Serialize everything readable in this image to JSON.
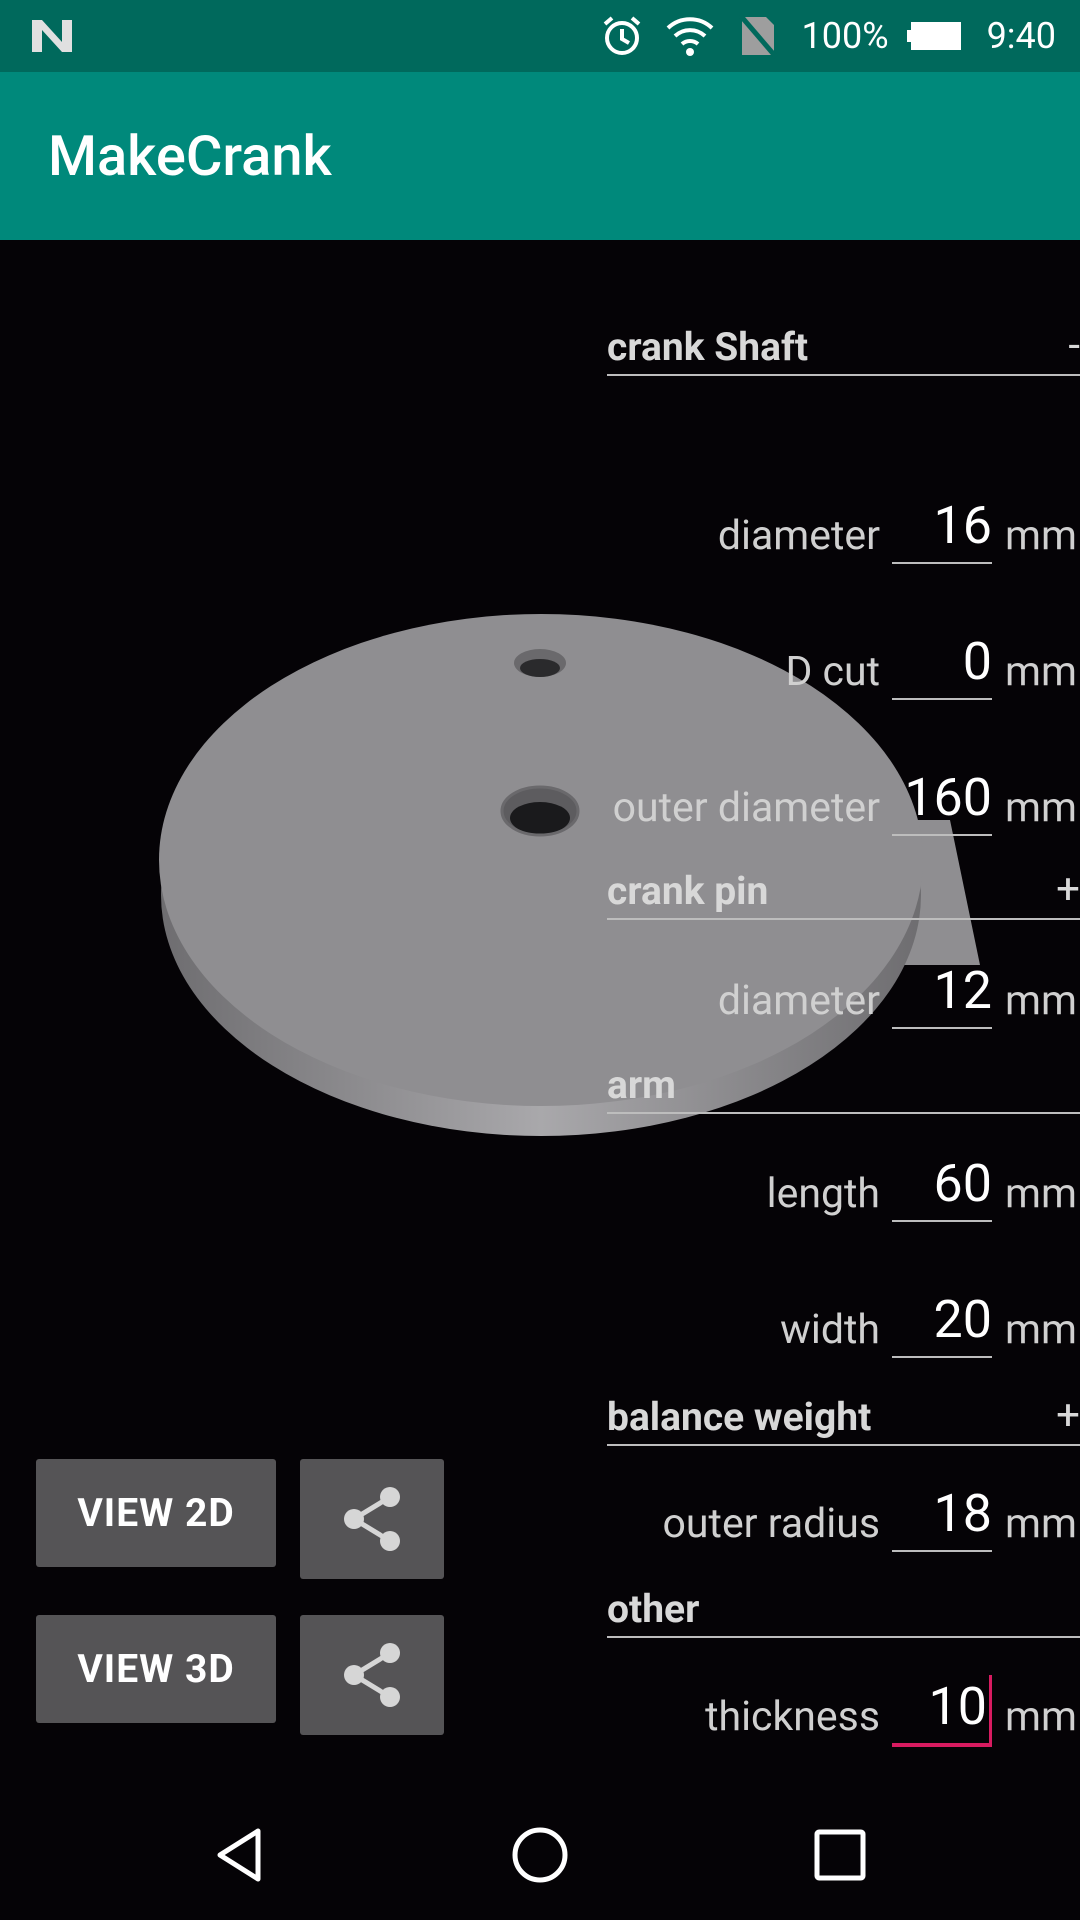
{
  "status_bar": {
    "battery": "100%",
    "time": "9:40",
    "icons": [
      "n-logo-icon",
      "alarm-icon",
      "wifi-icon",
      "no-sim-icon",
      "battery-icon"
    ]
  },
  "app_bar": {
    "title": "MakeCrank"
  },
  "sections": {
    "crank_shaft": {
      "label": "crank Shaft",
      "toggle": "-"
    },
    "crank_pin": {
      "label": "crank pin",
      "toggle": "+"
    },
    "arm": {
      "label": "arm",
      "toggle": ""
    },
    "balance_weight": {
      "label": "balance weight",
      "toggle": "+"
    },
    "other": {
      "label": "other",
      "toggle": ""
    }
  },
  "fields": {
    "shaft_diameter": {
      "label": "diameter",
      "value": "16",
      "unit": "mm"
    },
    "d_cut": {
      "label": "D cut",
      "value": "0",
      "unit": "mm"
    },
    "outer_diameter": {
      "label": "outer diameter",
      "value": "160",
      "unit": "mm"
    },
    "pin_diameter": {
      "label": "diameter",
      "value": "12",
      "unit": "mm"
    },
    "arm_length": {
      "label": "length",
      "value": "60",
      "unit": "mm"
    },
    "arm_width": {
      "label": "width",
      "value": "20",
      "unit": "mm"
    },
    "bw_outer_radius": {
      "label": "outer radius",
      "value": "18",
      "unit": "mm"
    },
    "thickness": {
      "label": "thickness",
      "value": "10",
      "unit": "mm"
    }
  },
  "buttons": {
    "view_2d": "VIEW 2D",
    "view_3d": "VIEW 3D",
    "share_icon": "share-icon"
  },
  "nav": {
    "icons": [
      "back-icon",
      "home-icon",
      "recents-icon"
    ]
  },
  "colors": {
    "status_bar": "#00695c",
    "app_bar": "#00897b",
    "background": "#050306",
    "accent": "#d81b60",
    "button": "#555456",
    "model": "#8f8e91"
  }
}
